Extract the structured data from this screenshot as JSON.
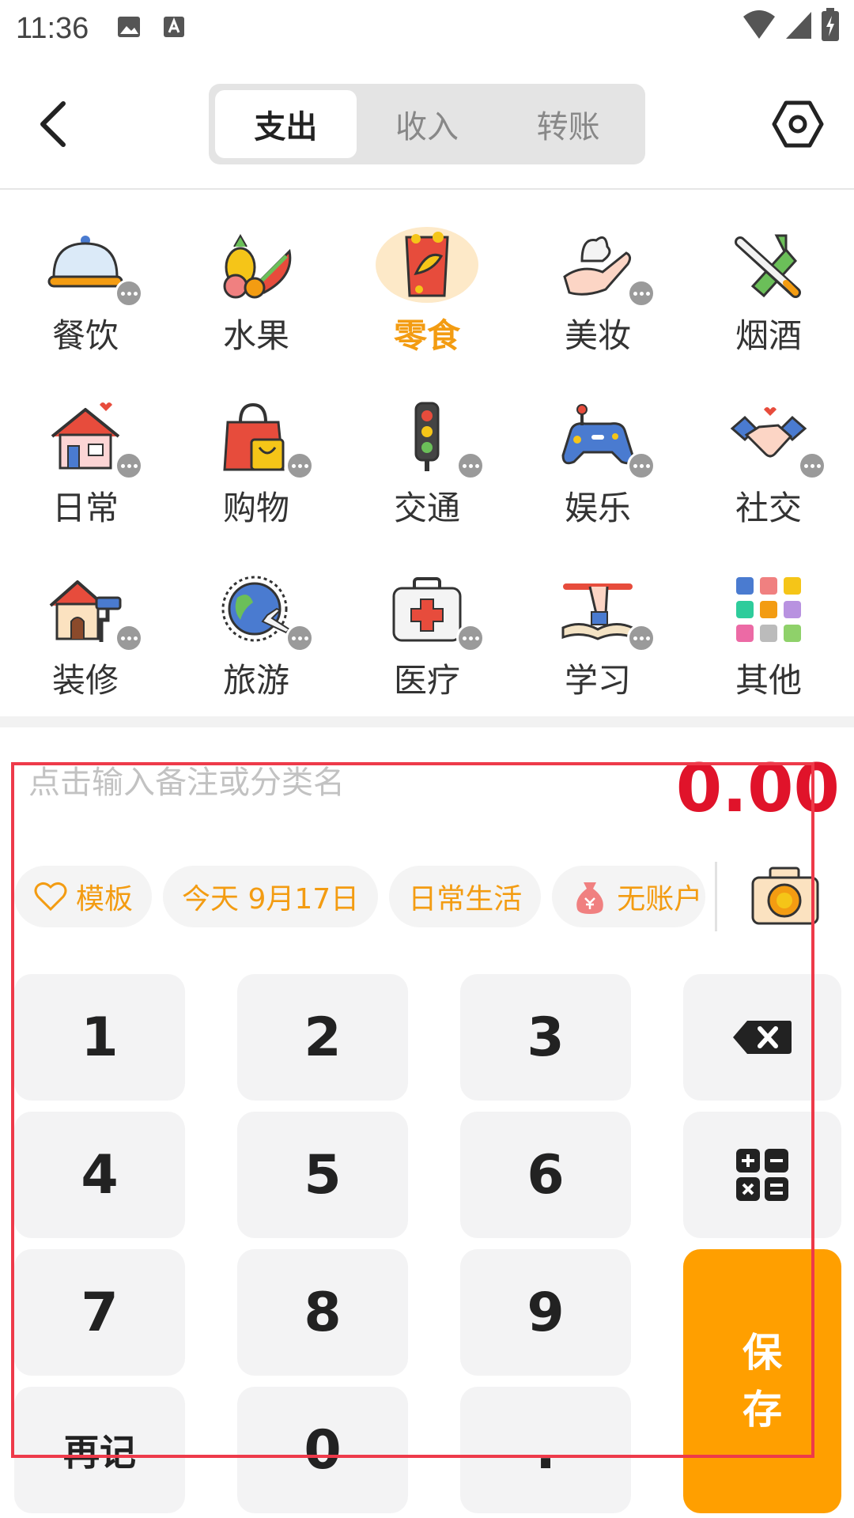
{
  "status_bar": {
    "time": "11:36"
  },
  "header": {
    "tabs": [
      {
        "label": "支出",
        "active": true
      },
      {
        "label": "收入",
        "active": false
      },
      {
        "label": "转账",
        "active": false
      }
    ]
  },
  "categories": [
    {
      "label": "餐饮",
      "icon": "dining-cloche-icon",
      "selected": false
    },
    {
      "label": "水果",
      "icon": "fruit-icon",
      "selected": false
    },
    {
      "label": "零食",
      "icon": "snack-bag-icon",
      "selected": true
    },
    {
      "label": "美妆",
      "icon": "cosmetics-hand-icon",
      "selected": false
    },
    {
      "label": "烟酒",
      "icon": "cigarette-wine-icon",
      "selected": false
    },
    {
      "label": "日常",
      "icon": "house-icon",
      "selected": false
    },
    {
      "label": "购物",
      "icon": "shopping-bag-icon",
      "selected": false
    },
    {
      "label": "交通",
      "icon": "traffic-light-icon",
      "selected": false
    },
    {
      "label": "娱乐",
      "icon": "gamepad-icon",
      "selected": false
    },
    {
      "label": "社交",
      "icon": "handshake-icon",
      "selected": false
    },
    {
      "label": "装修",
      "icon": "house-paint-icon",
      "selected": false
    },
    {
      "label": "旅游",
      "icon": "globe-plane-icon",
      "selected": false
    },
    {
      "label": "医疗",
      "icon": "first-aid-kit-icon",
      "selected": false
    },
    {
      "label": "学习",
      "icon": "book-pen-icon",
      "selected": false
    },
    {
      "label": "其他",
      "icon": "grid-apps-icon",
      "selected": false
    }
  ],
  "entry": {
    "note_placeholder": "点击输入备注或分类名",
    "amount": "0.00"
  },
  "chips": {
    "template": "模板",
    "date": "今天 9月17日",
    "book": "日常生活",
    "account": "无账户"
  },
  "keypad": {
    "k1": "1",
    "k2": "2",
    "k3": "3",
    "k4": "4",
    "k5": "5",
    "k6": "6",
    "k7": "7",
    "k8": "8",
    "k9": "9",
    "again": "再记",
    "k0": "0",
    "dot": ".",
    "save_1": "保",
    "save_2": "存"
  },
  "colors": {
    "accent": "#ff9f00",
    "amount": "#e0132a",
    "chip_text": "#f39c12"
  }
}
